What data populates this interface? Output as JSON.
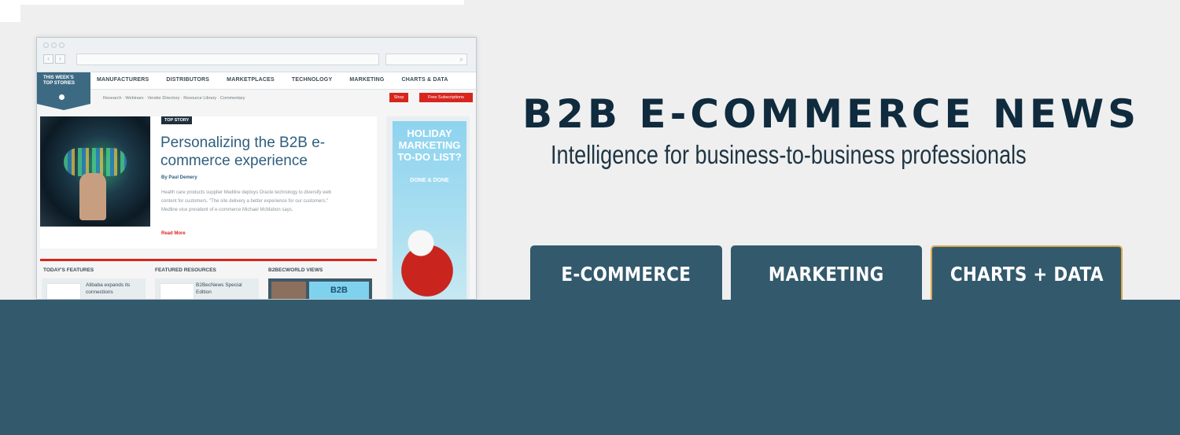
{
  "mockup": {
    "badge_line1": "THIS WEEK'S",
    "badge_line2": "TOP STORIES",
    "nav_items": [
      "MANUFACTURERS",
      "DISTRIBUTORS",
      "MARKETPLACES",
      "TECHNOLOGY",
      "MARKETING",
      "CHARTS & DATA"
    ],
    "subnav": "Research  ·  Webinars  ·  Vendor Directory  ·  Resource Library  ·  Commentary",
    "shop_button": "Shop",
    "subscriptions_button": "Free Subscriptions",
    "story": {
      "tag": "TOP STORY",
      "title": "Personalizing the B2B e-commerce experience",
      "byline": "By Paul Demery",
      "excerpt": "Health care products supplier Medline deploys Oracle technology to diversify web content for customers. \"The site delivery a better experience for our customers,\" Medline vice president of e-commerce Michael McMahon says.",
      "read_more": "Read More"
    },
    "ad": {
      "headline": "HOLIDAY MARKETING TO-DO LIST?",
      "done": "DONE & DONE"
    },
    "sections": {
      "features_title": "TODAY'S FEATURES",
      "features_item": "Alibaba expands its connections",
      "resources_title": "FEATURED RESOURCES",
      "resources_item": "B2BecNews Special Edition",
      "views_title": "B2BECWORLD VIEWS",
      "views_badge": "B2B"
    }
  },
  "brand": {
    "title": "B2B E-COMMERCE NEWS",
    "tagline": "Intelligence for business-to-business professionals"
  },
  "tabs": [
    {
      "label": "E-COMMERCE"
    },
    {
      "label": "MARKETING"
    },
    {
      "label": "CHARTS + DATA"
    }
  ],
  "colors": {
    "background": "#efefef",
    "navy_text": "#0f2b3d",
    "tab_bg": "#33596c",
    "tab_active_border": "#d7a84e"
  }
}
